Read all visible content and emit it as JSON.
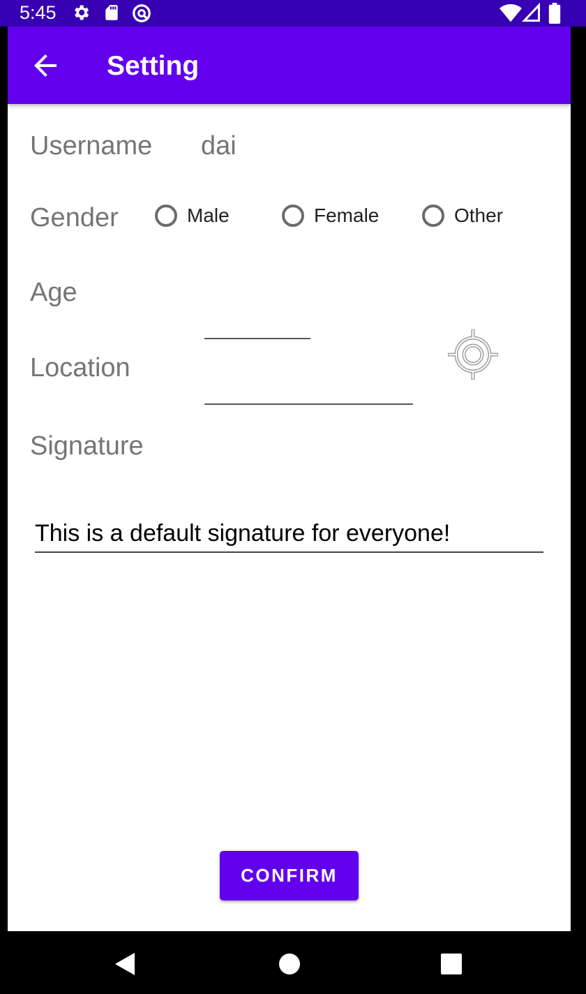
{
  "status_bar": {
    "time": "5:45",
    "left_icons": [
      "gear-icon",
      "sd-card-icon",
      "at-sign-icon"
    ],
    "right_icons": [
      "wifi-icon",
      "signal-icon",
      "battery-icon"
    ],
    "background": "#3700B3"
  },
  "toolbar": {
    "title": "Setting",
    "back_icon": "arrow-back-icon",
    "background": "#6200EE"
  },
  "form": {
    "username": {
      "label": "Username",
      "value": "dai"
    },
    "gender": {
      "label": "Gender",
      "options": [
        "Male",
        "Female",
        "Other"
      ],
      "selected": null
    },
    "age": {
      "label": "Age",
      "value": ""
    },
    "location": {
      "label": "Location",
      "value": "",
      "locate_icon": "gps-locate-icon"
    },
    "signature": {
      "label": "Signature",
      "value": "This is a default signature for everyone!"
    }
  },
  "confirm_button": {
    "label": "CONFIRM"
  },
  "nav_bar": {
    "icons": [
      "back-triangle-icon",
      "home-circle-icon",
      "recents-square-icon"
    ]
  }
}
